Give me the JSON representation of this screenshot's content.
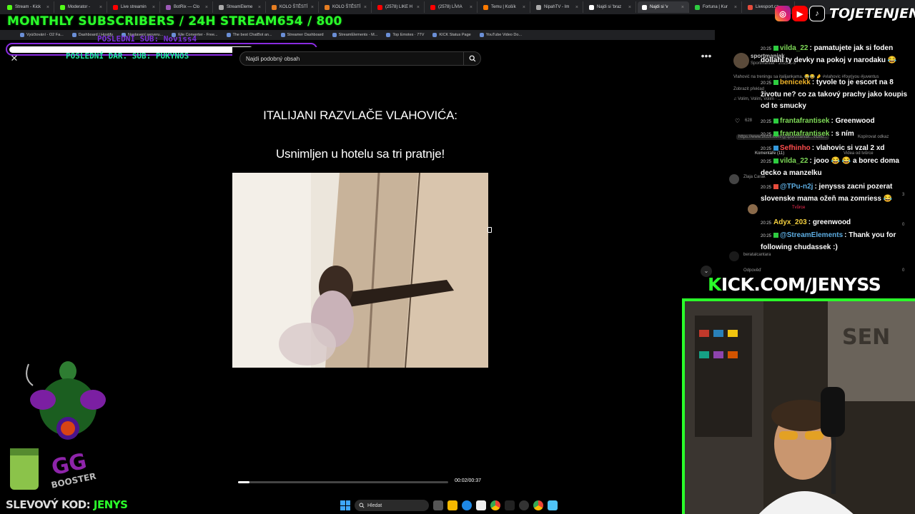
{
  "browser": {
    "tabs": [
      {
        "label": "Stream - Kick",
        "color": "#53fc18",
        "active": false
      },
      {
        "label": "Moderator -",
        "color": "#53fc18",
        "active": false
      },
      {
        "label": "Live streamin",
        "color": "#ff0000",
        "active": false
      },
      {
        "label": "BotRix — Clo",
        "color": "#9b59b6",
        "active": false
      },
      {
        "label": "StreamEleme",
        "color": "#aaaaaa",
        "active": false
      },
      {
        "label": "KOLO ŠTĚSTÍ",
        "color": "#e67e22",
        "active": false
      },
      {
        "label": "KOLO ŠTĚSTÍ",
        "color": "#e67e22",
        "active": false
      },
      {
        "label": "(2578) LIKE H",
        "color": "#ff0000",
        "active": false
      },
      {
        "label": "(2578) LÍVIA",
        "color": "#ff0000",
        "active": false
      },
      {
        "label": "Temu | Košík",
        "color": "#ff7a00",
        "active": false
      },
      {
        "label": "NipahTV - Im",
        "color": "#aaaaaa",
        "active": false
      },
      {
        "label": "Najdi si 'braz",
        "color": "#ffffff",
        "active": false
      },
      {
        "label": "Najdi si 'v",
        "color": "#ffffff",
        "active": true
      },
      {
        "label": "Fortuna | Kur",
        "color": "#2ecc40",
        "active": false
      },
      {
        "label": "Livesport.cz",
        "color": "#e74c3c",
        "active": false
      }
    ],
    "bookmarks": [
      "Vyúčtování - O2 Fa...",
      "Dashboard | Hostify",
      "Nastavení serveru...",
      "File Converter - Free...",
      "The best ChatBot an...",
      "Streamer Dashboard",
      "StreamElements - M...",
      "Top Emotes · 7TV",
      "KICK Status Page",
      "YouTube Video Do..."
    ]
  },
  "overlay": {
    "subscribers_banner": "MONTHLY SUBSCRIBERS / 24H STREAM654 / 800",
    "last_sub": "POSLEDNÍ SUB: Noviss4",
    "last_donation": "POSLEDNÍ DAR. SUB: PUKYNOS",
    "goal_progress": 0.8,
    "social_handle": "TOJETENJENYS",
    "kick_url": {
      "prefix": "K",
      "rest": "ICK.COM/JENYSS"
    },
    "promo_label": "SLEVOVÝ KOD:",
    "promo_code": "JENYS",
    "accent": "#2aff2a"
  },
  "video": {
    "search_placeholder": "Najdi podobný obsah",
    "caption_line1": "ITALIJANI RAZVLAČE VLAHOVIĆA:",
    "caption_line2": "Usnimljen u hotelu sa tri pratnje!",
    "time": "00:02/00:37",
    "progress": 0.054
  },
  "tiktok": {
    "author": "sportmaniak",
    "author_sub": "Sportmaniak · 2025-1-9",
    "description": "Vlahović na treningu sa italijankama. 😂😂 🤌 #vlahovic #fourjyou #juventus",
    "translate": "Zobrazit překlad",
    "music": "♫ Volim, Volim, Volim · ...",
    "likes": "628",
    "link": "https://www.tiktok.com/@sportmaniak...video...",
    "copy_link": "Kopírovat odkaz",
    "comments_tab": "Komentáře (11)",
    "creator_videos_tab": "Videa od tvůrce",
    "commenter1": "Zlaja Carak",
    "creator_label": "Tvůrce",
    "commenter2": "beratalcantara",
    "reply": "Odpověď",
    "like_zero": "0",
    "like_three": "3"
  },
  "chat": [
    {
      "time": "20:25",
      "badge": "green",
      "user": "vilda_22",
      "color": "#7ed957",
      "text": ": pamatujete jak si foden dollahl ty devky na pokoj v narodaku 😂"
    },
    {
      "time": "20:25",
      "badge": "green",
      "user": "benicekk",
      "color": "#f0b429",
      "text": ": tyvole to je escort na 8 životu ne? co za takový prachy jako koupis od te smucky"
    },
    {
      "time": "20:25",
      "badge": "green",
      "user": "frantafrantisek",
      "color": "#7ed957",
      "text": ": Greenwood"
    },
    {
      "time": "20:25",
      "badge": "green",
      "user": "frantafrantisek",
      "color": "#7ed957",
      "text": ": s ním"
    },
    {
      "time": "20:25",
      "badge": "blue",
      "user": "Sefhinho",
      "color": "#ff4d4d",
      "text": ": vlahovic si vzal 2 xd"
    },
    {
      "time": "20:25",
      "badge": "green",
      "user": "vilda_22",
      "color": "#7ed957",
      "text": ": jooo 😂 😂 a borec doma decko a manzelku"
    },
    {
      "time": "20:25",
      "badge": "red",
      "user": "@TPu-n2j",
      "color": "#5dade2",
      "text": ": jenysss zacni pozerat slovenske mama ožeň ma zomriess 😂"
    },
    {
      "time": "20:25",
      "badge": "none",
      "user": "Adyx_203",
      "color": "#f4d03f",
      "text": ": greenwood"
    },
    {
      "time": "20:25",
      "badge": "green",
      "user": "@StreamElements",
      "color": "#5dade2",
      "text": ": Thank you for following chudassek :)"
    }
  ],
  "taskbar": {
    "search_label": "Hledat"
  }
}
